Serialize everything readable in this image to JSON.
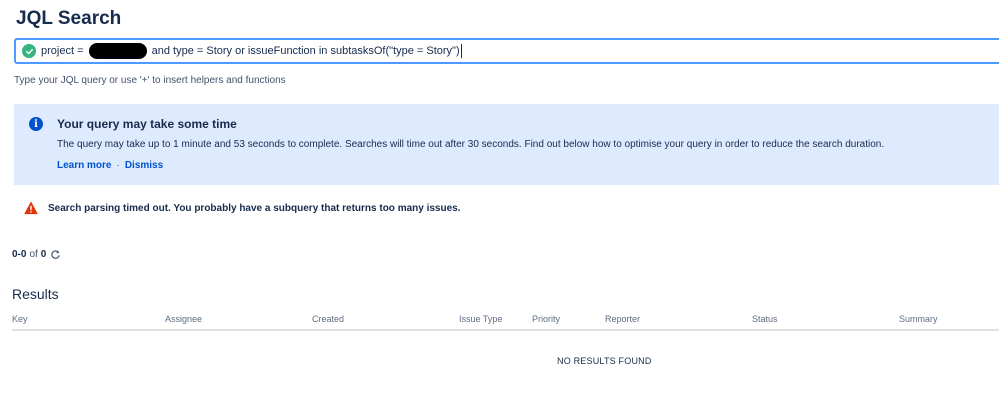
{
  "page": {
    "title": "JQL Search"
  },
  "jql": {
    "status_icon": "check-circle-icon",
    "prefix": "project = ",
    "suffix": " and type = Story or issueFunction in subtasksOf(\"type = Story\")"
  },
  "help_text": "Type your JQL query or use '+' to insert helpers and functions",
  "info_banner": {
    "icon": "info-icon",
    "title": "Your query may take some time",
    "body": "The query may take up to 1 minute and 53 seconds to complete. Searches will time out after 30 seconds. Find out below how to optimise your query in order to reduce the search duration.",
    "learn_more": "Learn more",
    "separator": "·",
    "dismiss": "Dismiss",
    "background": "#deebff"
  },
  "error": {
    "icon": "warning-icon",
    "text": "Search parsing timed out. You probably have a subquery that returns too many issues.",
    "color": "#de350b"
  },
  "count": {
    "range": "0-0",
    "of": "of",
    "total": "0",
    "refresh_icon": "refresh-icon"
  },
  "results": {
    "title": "Results",
    "columns": [
      "Key",
      "Assignee",
      "Created",
      "Issue Type",
      "Priority",
      "Reporter",
      "Status",
      "Summary"
    ],
    "empty": "NO RESULTS FOUND"
  },
  "colors": {
    "accent": "#0052cc",
    "focus_border": "#4c9aff",
    "success": "#36b37e"
  }
}
